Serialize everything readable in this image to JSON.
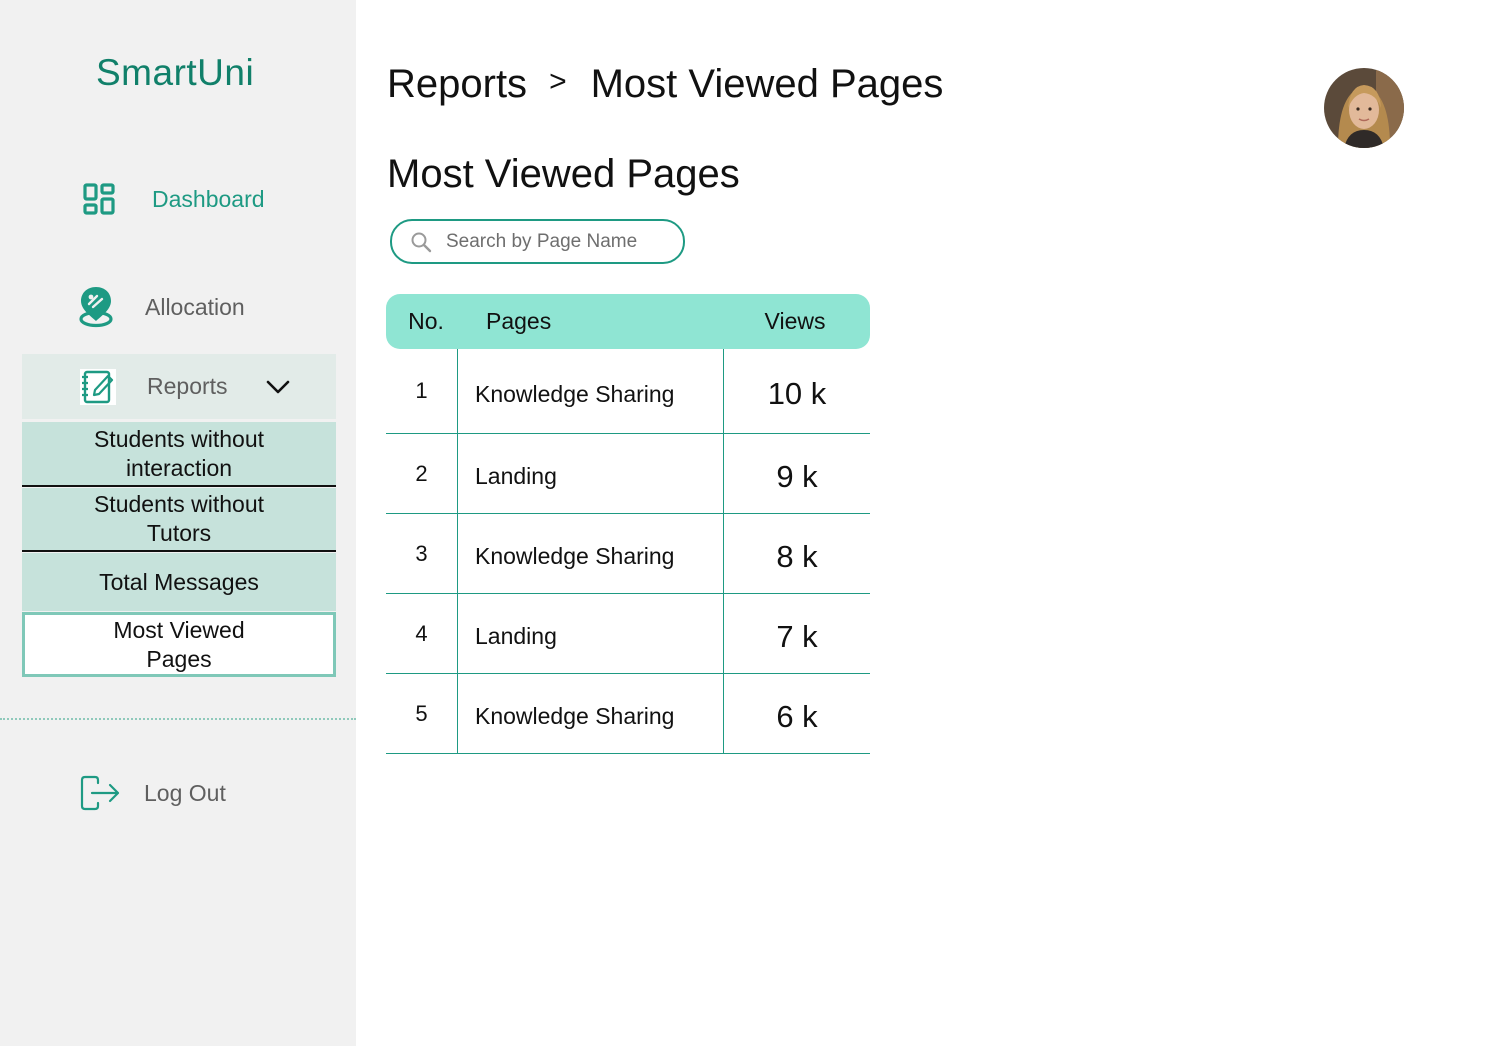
{
  "app": {
    "brand": "SmartUni"
  },
  "colors": {
    "accent": "#1e9a83",
    "brand": "#11806a",
    "table_header": "#8fe5d3",
    "submenu_bg": "#c6e2db"
  },
  "sidebar": {
    "items": [
      {
        "label": "Dashboard",
        "icon": "dashboard-icon"
      },
      {
        "label": "Allocation",
        "icon": "allocation-icon"
      },
      {
        "label": "Reports",
        "icon": "reports-icon",
        "expanded": true
      }
    ],
    "reports_submenu": [
      {
        "label": "Students without interaction"
      },
      {
        "label": "Students without Tutors"
      },
      {
        "label": "Total Messages"
      },
      {
        "label": "Most Viewed Pages",
        "active": true
      }
    ],
    "logout_label": "Log Out"
  },
  "header": {
    "breadcrumb": {
      "root": "Reports",
      "separator": ">",
      "current": "Most Viewed Pages"
    }
  },
  "main": {
    "title": "Most Viewed Pages",
    "search": {
      "placeholder": "Search by Page Name",
      "value": ""
    },
    "table": {
      "headers": {
        "no": "No.",
        "pages": "Pages",
        "views": "Views"
      },
      "rows": [
        {
          "no": "1",
          "page": "Knowledge Sharing",
          "views": "10 k"
        },
        {
          "no": "2",
          "page": "Landing",
          "views": "9 k"
        },
        {
          "no": "3",
          "page": "Knowledge Sharing",
          "views": "8 k"
        },
        {
          "no": "4",
          "page": "Landing",
          "views": "7 k"
        },
        {
          "no": "5",
          "page": "Knowledge Sharing",
          "views": "6 k"
        }
      ]
    }
  }
}
